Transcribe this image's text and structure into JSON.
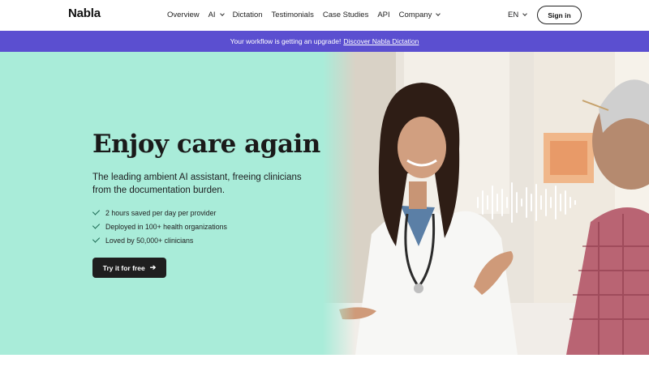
{
  "brand": {
    "logo": "Nabla"
  },
  "nav": {
    "items": [
      {
        "label": "Overview",
        "dropdown": false
      },
      {
        "label": "AI",
        "dropdown": true
      },
      {
        "label": "Dictation",
        "dropdown": false
      },
      {
        "label": "Testimonials",
        "dropdown": false
      },
      {
        "label": "Case Studies",
        "dropdown": false
      },
      {
        "label": "API",
        "dropdown": false
      },
      {
        "label": "Company",
        "dropdown": true
      }
    ],
    "language": "EN",
    "signin_label": "Sign in"
  },
  "banner": {
    "text": "Your workflow is getting an upgrade!",
    "link_text": "Discover Nabla Dictation",
    "color": "#5b4fd0"
  },
  "hero": {
    "headline": "Enjoy care again",
    "subline": "The leading ambient AI assistant, freeing clinicians from the documentation burden.",
    "checks": [
      "2 hours saved per day per provider",
      "Deployed in 100+ health organizations",
      "Loved by 50,000+ clinicians"
    ],
    "cta_label": "Try it for free",
    "background": "#a9ecd9"
  },
  "icons": {
    "nav_dropdown": "chevron-down-icon",
    "check": "check-icon",
    "cta": "arrow-right-icon",
    "waveform": "audio-waveform-icon"
  }
}
